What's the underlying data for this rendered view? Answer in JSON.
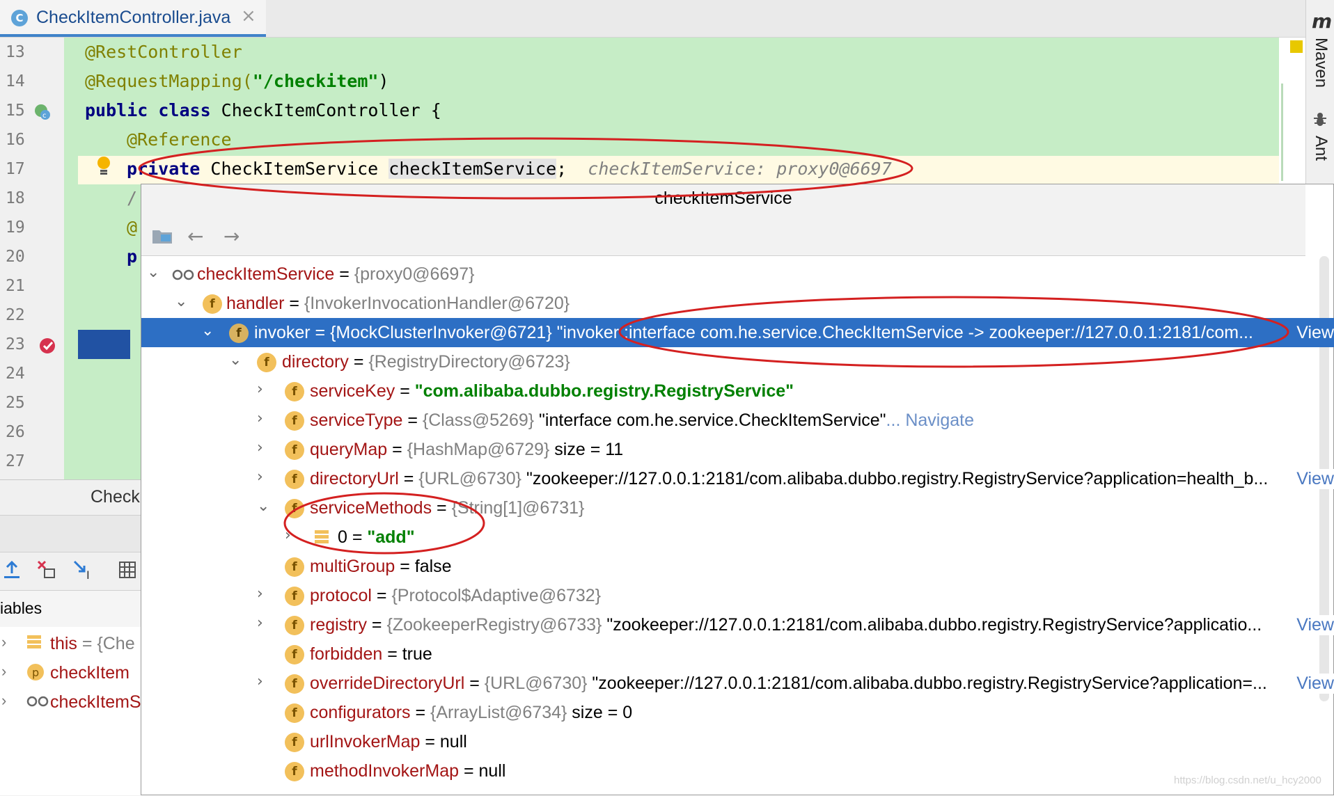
{
  "tab": {
    "icon_letter": "C",
    "filename": "CheckItemController.java",
    "close": "×"
  },
  "right_tools": {
    "maven_icon": "m",
    "maven": "Maven",
    "ant": "Ant"
  },
  "gutter": {
    "lines": [
      "13",
      "14",
      "15",
      "16",
      "17",
      "18",
      "19",
      "20",
      "21",
      "22",
      "23",
      "24",
      "25",
      "26",
      "27"
    ]
  },
  "code": {
    "l13": "@RestController",
    "l14_ann": "@RequestMapping(",
    "l14_str": "\"/checkitem\"",
    "l14_end": ")",
    "l15_kw": "public class",
    "l15_rest": " CheckItemController {",
    "l16": "@Reference",
    "l17_kw": "private",
    "l17_type": " CheckItemService ",
    "l17_field": "checkItemService",
    "l17_semi": ";",
    "l17_hint": "checkItemService: proxy0@6697",
    "l18": "/",
    "l19": "@",
    "l20": "p"
  },
  "bottom_panel": {
    "tab_label": "Check",
    "variables_header": "iables",
    "variables": [
      {
        "name": "this",
        "value": "= {Che"
      },
      {
        "name": "checkItem",
        "value": ""
      },
      {
        "name": "checkItemS",
        "value": ""
      }
    ]
  },
  "popup": {
    "title": "checkItemService",
    "rows": [
      {
        "name": "checkItemService",
        "rest": " = ",
        "ref": "{proxy0@6697}"
      },
      {
        "name": "handler",
        "rest": " = ",
        "ref": "{InvokerInvocationHandler@6720}"
      },
      {
        "name": "invoker",
        "rest": " = {MockClusterInvoker@6721} \"invoker :interface com.he.service.CheckItemService -> zookeeper://127.0.0.1:2181/com...",
        "link": " View"
      },
      {
        "name": "directory",
        "rest": " = ",
        "ref": "{RegistryDirectory@6723}"
      },
      {
        "name": "serviceKey",
        "rest": " = ",
        "str": "\"com.alibaba.dubbo.registry.RegistryService\""
      },
      {
        "name": "serviceType",
        "rest": " = ",
        "ref": "{Class@5269}",
        "tail": " \"interface com.he.service.CheckItemService\"",
        "nav": "... Navigate"
      },
      {
        "name": "queryMap",
        "rest": " = ",
        "ref": "{HashMap@6729}",
        "tail": "  size = 11"
      },
      {
        "name": "directoryUrl",
        "rest": " = ",
        "ref": "{URL@6730}",
        "tail": " \"zookeeper://127.0.0.1:2181/com.alibaba.dubbo.registry.RegistryService?application=health_b...",
        "link": " View"
      },
      {
        "name": "serviceMethods",
        "rest": " = ",
        "ref": "{String[1]@6731}"
      },
      {
        "name": "0",
        "rest": " = ",
        "str": "\"add\""
      },
      {
        "name": "multiGroup",
        "rest": " = false"
      },
      {
        "name": "protocol",
        "rest": " = ",
        "ref": "{Protocol$Adaptive@6732}"
      },
      {
        "name": "registry",
        "rest": " = ",
        "ref": "{ZookeeperRegistry@6733}",
        "tail": " \"zookeeper://127.0.0.1:2181/com.alibaba.dubbo.registry.RegistryService?applicatio...",
        "link": " View"
      },
      {
        "name": "forbidden",
        "rest": " = true"
      },
      {
        "name": "overrideDirectoryUrl",
        "rest": " = ",
        "ref": "{URL@6730}",
        "tail": " \"zookeeper://127.0.0.1:2181/com.alibaba.dubbo.registry.RegistryService?application=...",
        "link": " View"
      },
      {
        "name": "configurators",
        "rest": " = ",
        "ref": "{ArrayList@6734}",
        "tail": "  size = 0"
      },
      {
        "name": "urlInvokerMap",
        "rest": " = null"
      },
      {
        "name": "methodInvokerMap",
        "rest": " = null"
      }
    ]
  },
  "watermark": "https://blog.csdn.net/u_hcy2000",
  "colors": {
    "selection": "#2d6fc4",
    "green_bg": "#c6edc6",
    "annotation_ellipse": "#d42020"
  }
}
